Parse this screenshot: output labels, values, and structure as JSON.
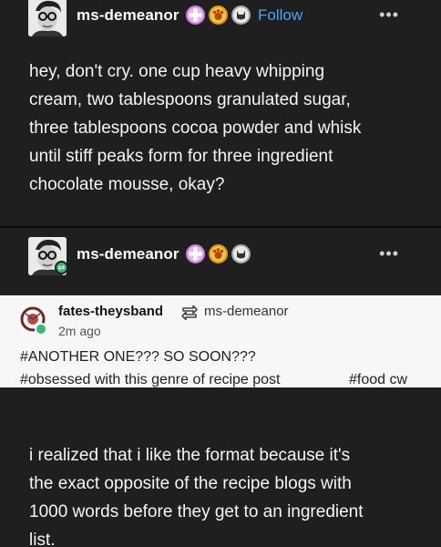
{
  "post1": {
    "username": "ms-demeanor",
    "follow_label": "Follow",
    "more_label": "•••",
    "body": "hey, don't cry. one cup heavy whipping\ncream, two tablespoons granulated sugar,\nthree tablespoons cocoa powder and whisk\nuntil stiff peaks form for three ingredient\nchocolate mousse, okay?"
  },
  "post2": {
    "username": "ms-demeanor",
    "more_label": "•••",
    "quote": {
      "author": "fates-theysband",
      "reblogged_from": "ms-demeanor",
      "time": "2m ago"
    },
    "tags": {
      "tag1": "#ANOTHER ONE??? SO SOON???",
      "tag2": "#obsessed with this genre of recipe post",
      "tag3": "#food cw"
    },
    "body": "i realized that i like the format because it's\nthe exact opposite of the recipe blogs with\n1000 words before they get to an ingredient\nlist."
  },
  "colors": {
    "background": "#1f1f1f",
    "follow": "#4aa3ff",
    "reblog_green": "#2dbf6a",
    "quote_bg": "#f7f7f7"
  }
}
